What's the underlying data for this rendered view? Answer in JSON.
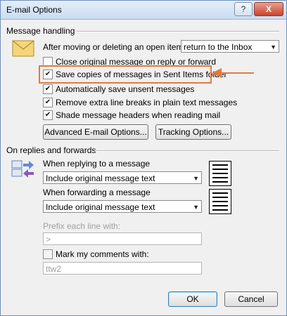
{
  "window": {
    "title": "E-mail Options",
    "help_label": "?",
    "close_label": "X"
  },
  "message_handling": {
    "header": "Message handling",
    "after_moving_label": "After moving or deleting an open item:",
    "after_moving_value": "return to the Inbox",
    "close_original_label": "Close original message on reply or forward",
    "close_original_checked": false,
    "save_copies_label": "Save copies of messages in Sent Items folder",
    "save_copies_checked": true,
    "auto_save_label": "Automatically save unsent messages",
    "auto_save_checked": true,
    "remove_breaks_label": "Remove extra line breaks in plain text messages",
    "remove_breaks_checked": true,
    "shade_headers_label": "Shade message headers when reading mail",
    "shade_headers_checked": true,
    "advanced_button": "Advanced E-mail Options...",
    "tracking_button": "Tracking Options..."
  },
  "replies_forwards": {
    "header": "On replies and forwards",
    "replying_label": "When replying to a message",
    "replying_value": "Include original message text",
    "forwarding_label": "When forwarding a message",
    "forwarding_value": "Include original message text",
    "prefix_label": "Prefix each line with:",
    "prefix_value": ">",
    "mark_comments_label": "Mark my comments with:",
    "mark_comments_checked": false,
    "mark_comments_value": "ttw2"
  },
  "footer": {
    "ok_label": "OK",
    "cancel_label": "Cancel"
  },
  "colors": {
    "highlight": "#e07b3c",
    "title_gradient_top": "#e4eef9"
  },
  "icons": [
    "envelope-icon",
    "reply-forward-icon",
    "preview-icon",
    "dropdown-arrow-icon",
    "callout-arrow-icon"
  ]
}
